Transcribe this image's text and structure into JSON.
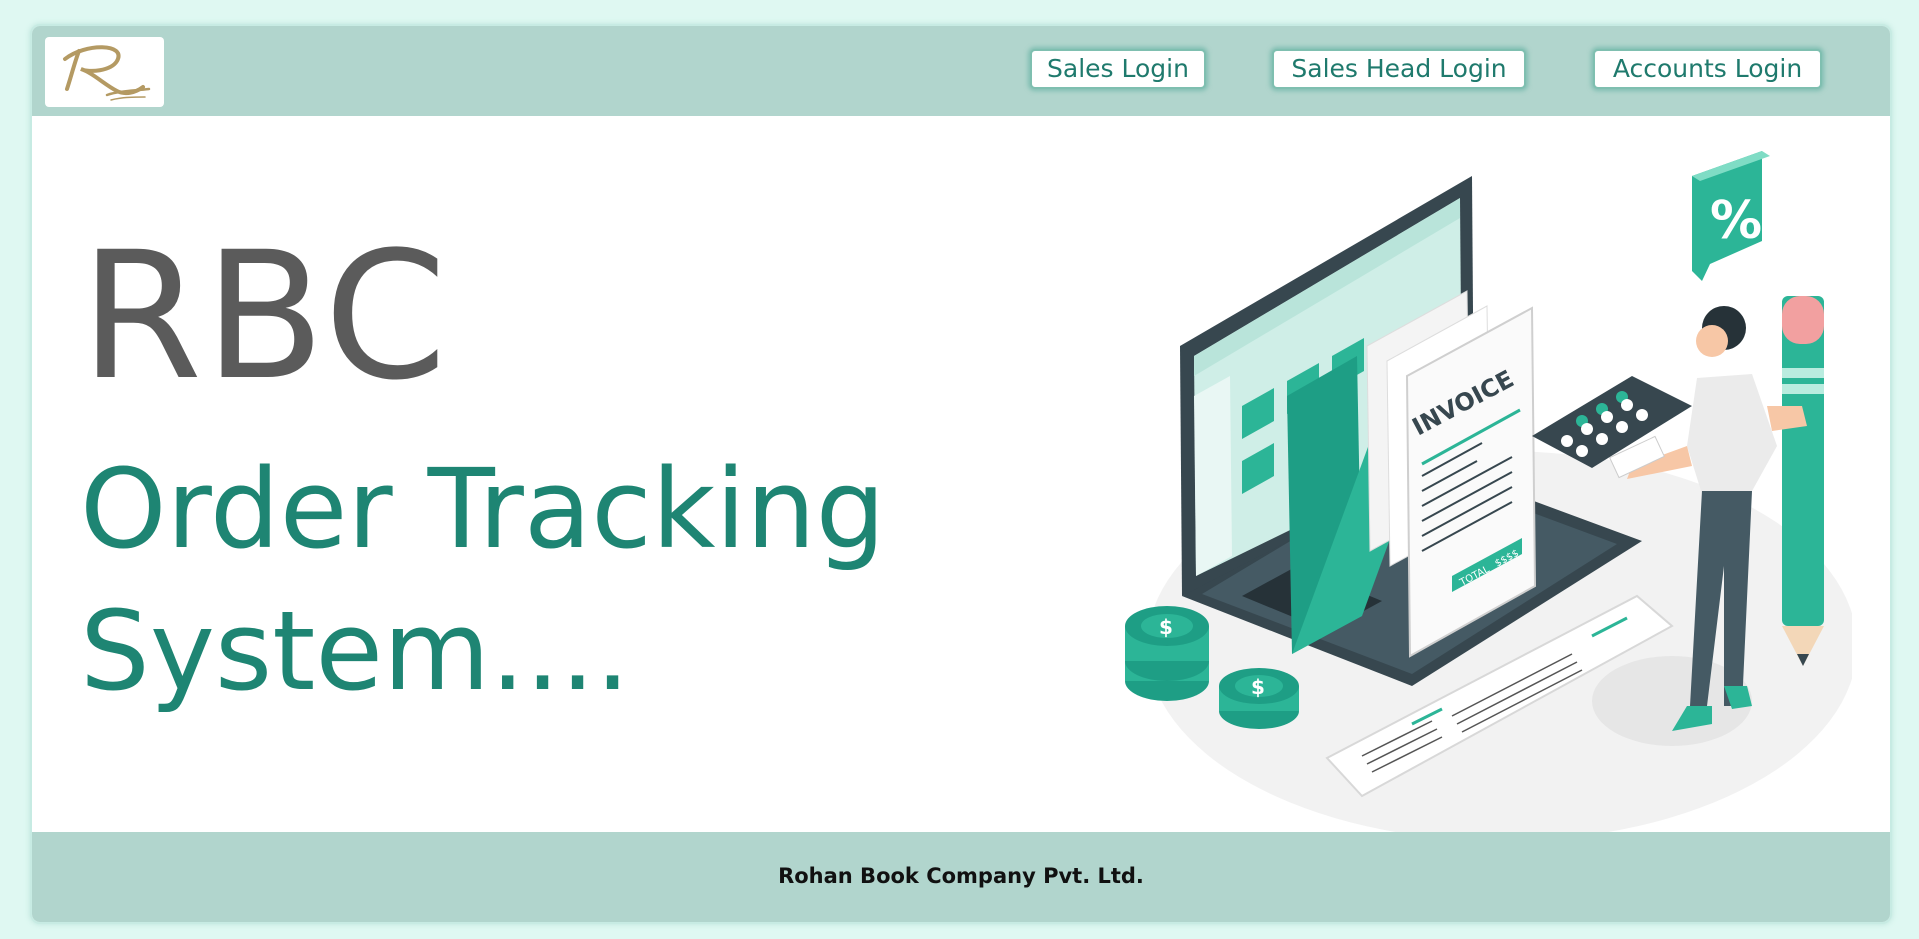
{
  "header": {
    "logo_alt": "RBC logo",
    "nav": [
      {
        "label": "Sales Login"
      },
      {
        "label": "Sales Head Login"
      },
      {
        "label": "Accounts Login"
      }
    ]
  },
  "hero": {
    "acronym": "RBC",
    "line1": "Order Tracking",
    "line2": "System...."
  },
  "illustration": {
    "invoice_title": "INVOICE",
    "total_label": "TOTAL",
    "total_value": "$$$$",
    "percent_symbol": "%",
    "coin_symbol": "$"
  },
  "footer": {
    "company": "Rohan Book Company Pvt. Ltd."
  },
  "colors": {
    "accent": "#1e8573",
    "header_bg": "#b1d5cd",
    "page_bg": "#dff8f2",
    "teal_illustration": "#2cb597"
  }
}
